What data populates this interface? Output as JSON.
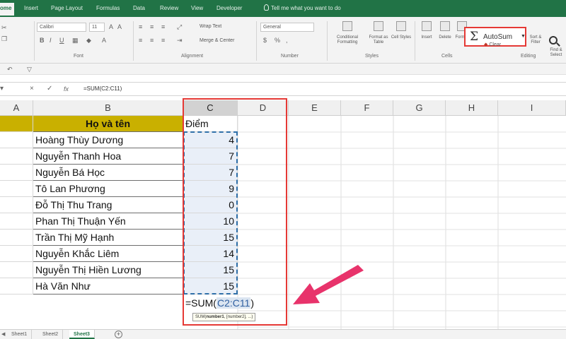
{
  "ribbon_tabs": [
    {
      "label": "ome",
      "active": true
    },
    {
      "label": "Insert"
    },
    {
      "label": "Page Layout"
    },
    {
      "label": "Formulas"
    },
    {
      "label": "Data"
    },
    {
      "label": "Review"
    },
    {
      "label": "View"
    },
    {
      "label": "Developer"
    }
  ],
  "tell_me": "Tell me what you want to do",
  "font": {
    "name": "Calibri",
    "size": "11"
  },
  "number_format": "General",
  "wrap_text": "Wrap Text",
  "merge_center": "Merge & Center",
  "styles": {
    "conditional": "Conditional Formatting",
    "format_table": "Format as Table",
    "cell_styles": "Cell Styles"
  },
  "cells_group": {
    "insert": "Insert",
    "delete": "Delete",
    "format": "Format"
  },
  "clear": "Clear",
  "sort_filter": "Sort & Filter",
  "find_select": "Find & Select",
  "groups": {
    "font": "Font",
    "alignment": "Alignment",
    "number": "Number",
    "styles": "Styles",
    "cells": "Cells",
    "editing": "Editing"
  },
  "autosum": {
    "icon": "sigma-icon",
    "label": "AutoSum"
  },
  "formula_bar": {
    "cancel": "×",
    "enter": "✓",
    "fx": "fx",
    "formula": "=SUM(C2:C11)"
  },
  "columns": [
    "A",
    "B",
    "C",
    "D",
    "E",
    "F",
    "G",
    "H",
    "I"
  ],
  "table": {
    "header_name": "Họ và tên",
    "header_score": "Điểm",
    "rows": [
      {
        "name": "Hoàng Thùy Dương",
        "score": "4"
      },
      {
        "name": "Nguyễn Thanh Hoa",
        "score": "7"
      },
      {
        "name": "Nguyễn Bá Học",
        "score": "7"
      },
      {
        "name": "Tô Lan Phương",
        "score": "9"
      },
      {
        "name": "Đỗ Thị Thu Trang",
        "score": "0"
      },
      {
        "name": "Phan Thị Thuận Yến",
        "score": "10"
      },
      {
        "name": "Trần Thị Mỹ Hạnh",
        "score": "15"
      },
      {
        "name": "Nguyễn Khắc Liêm",
        "score": "14"
      },
      {
        "name": "Nguyễn Thị Hiền Lương",
        "score": "15"
      },
      {
        "name": "Hà Văn Như",
        "score": "15"
      }
    ]
  },
  "formula_cell": {
    "prefix": "=SUM(",
    "range": "C2:C11",
    "suffix": ")"
  },
  "tooltip": {
    "fn": "SUM(",
    "arg1": "number1",
    "rest": ", [number2], ...)"
  },
  "sheets": [
    {
      "label": "Sheet1"
    },
    {
      "label": "Sheet2"
    },
    {
      "label": "Sheet3",
      "active": true
    }
  ],
  "colors": {
    "accent": "#217346",
    "highlight": "#e53935",
    "header_fill": "#c9b000",
    "arrow": "#e8336b"
  }
}
